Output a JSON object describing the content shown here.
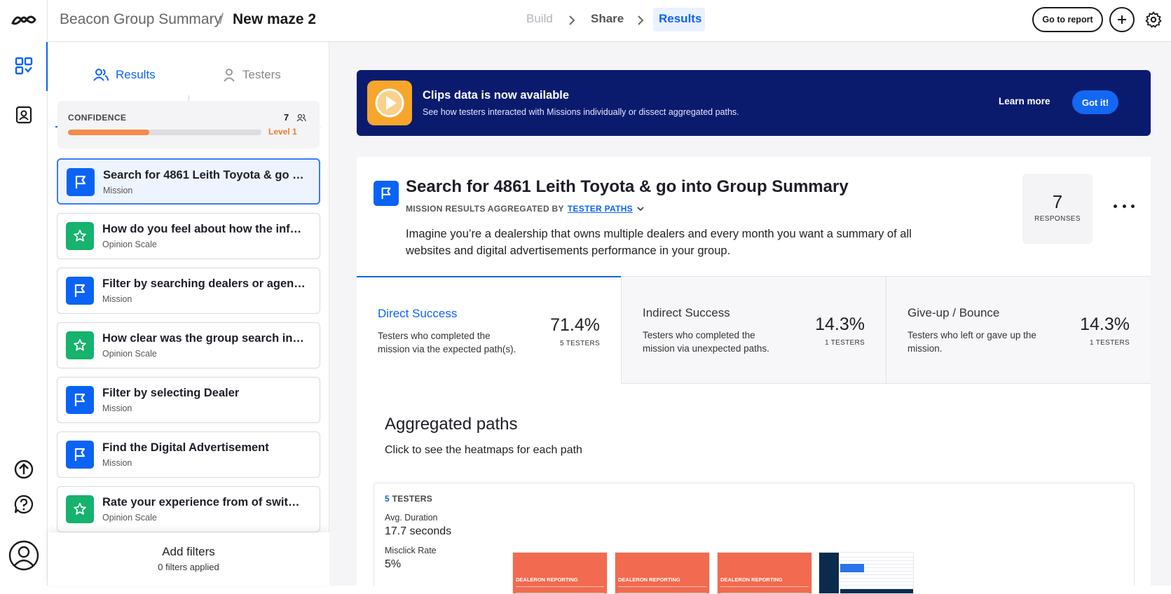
{
  "breadcrumb": {
    "project": "Beacon Group Summary",
    "separator": "/",
    "maze": "New maze 2"
  },
  "steps": {
    "build": "Build",
    "share": "Share",
    "results": "Results"
  },
  "header_actions": {
    "go_to_report": "Go to report"
  },
  "sidebar": {
    "tabs": {
      "results": "Results",
      "testers": "Testers"
    },
    "confidence": {
      "label": "CONFIDENCE",
      "count": "7",
      "level": "Level 1",
      "progress": 0.42
    },
    "tasks": [
      {
        "title": "Search for 4861 Leith Toyota & go in...",
        "subtitle": "Mission",
        "kind": "mission"
      },
      {
        "title": "How do you feel about how the infor...",
        "subtitle": "Opinion Scale",
        "kind": "opinion"
      },
      {
        "title": "Filter by searching dealers or agency",
        "subtitle": "Mission",
        "kind": "mission"
      },
      {
        "title": "How clear was the group search inte...",
        "subtitle": "Opinion Scale",
        "kind": "opinion"
      },
      {
        "title": "Filter by selecting Dealer",
        "subtitle": "Mission",
        "kind": "mission"
      },
      {
        "title": "Find the Digital Advertisement",
        "subtitle": "Mission",
        "kind": "mission"
      },
      {
        "title": "Rate your experience from of switch...",
        "subtitle": "Opinion Scale",
        "kind": "opinion"
      }
    ],
    "filters": {
      "title": "Add filters",
      "subtitle": "0 filters applied"
    }
  },
  "banner": {
    "title": "Clips data is now available",
    "subtitle": "See how testers interacted with Missions individually or dissect aggregated paths.",
    "learn_more": "Learn more",
    "got_it": "Got it!"
  },
  "mission": {
    "title": "Search for 4861 Leith Toyota & go into Group Summary",
    "aggregated_label": "MISSION RESULTS AGGREGATED BY",
    "aggregated_value": "TESTER PATHS",
    "description": "Imagine you’re a dealership that owns multiple dealers and every month you want a summary of all websites and digital advertisements performance in your group.",
    "responses_count": "7",
    "responses_label": "RESPONSES"
  },
  "stats": [
    {
      "title": "Direct Success",
      "desc": "Testers who completed the mission via the expected path(s).",
      "pct": "71.4%",
      "testers": "5 TESTERS"
    },
    {
      "title": "Indirect Success",
      "desc": "Testers who completed the mission via unexpected paths.",
      "pct": "14.3%",
      "testers": "1 TESTERS"
    },
    {
      "title": "Give-up / Bounce",
      "desc": "Testers who left or gave up the mission.",
      "pct": "14.3%",
      "testers": "1 TESTERS"
    }
  ],
  "paths": {
    "title": "Aggregated paths",
    "subtitle": "Click to see the heatmaps for each path",
    "testers_count": "5",
    "testers_label": "TESTERS",
    "avg_duration_label": "Avg. Duration",
    "avg_duration_value": "17.7 seconds",
    "misclick_label": "Misclick Rate",
    "misclick_value": "5%",
    "thumb_caption": "DEALERON REPORTING"
  },
  "colors": {
    "accent": "#0b63f5",
    "banner": "#0a1b6e",
    "mission_icon": "#0b63f5",
    "opinion_icon": "#15b36b",
    "progress": "#f58a4b"
  }
}
